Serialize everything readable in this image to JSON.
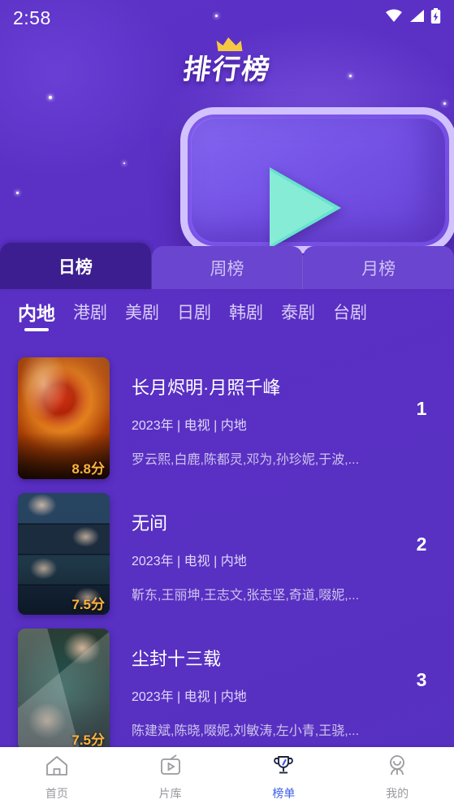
{
  "status_bar": {
    "time": "2:58",
    "icons": [
      "wifi-icon",
      "signal-icon",
      "battery-charging-icon"
    ]
  },
  "banner": {
    "title": "排行榜",
    "crown_color": "#f5c842",
    "play_icon_color": "#67e3cd",
    "background_color": "#5a2fc4"
  },
  "period_tabs": {
    "active_index": 0,
    "items": [
      {
        "label": "日榜"
      },
      {
        "label": "周榜"
      },
      {
        "label": "月榜"
      }
    ]
  },
  "category_tabs": {
    "active_index": 0,
    "items": [
      {
        "label": "内地"
      },
      {
        "label": "港剧"
      },
      {
        "label": "美剧"
      },
      {
        "label": "日剧"
      },
      {
        "label": "韩剧"
      },
      {
        "label": "泰剧"
      },
      {
        "label": "台剧"
      }
    ]
  },
  "ranking_list": [
    {
      "rank": "1",
      "title": "长月烬明·月照千峰",
      "meta": "2023年 | 电视 | 内地",
      "cast": "罗云熙,白鹿,陈都灵,邓为,孙珍妮,于波,...",
      "score": "8.8分"
    },
    {
      "rank": "2",
      "title": "无间",
      "meta": "2023年 | 电视 | 内地",
      "cast": "靳东,王丽坤,王志文,张志坚,奇道,啜妮,...",
      "score": "7.5分"
    },
    {
      "rank": "3",
      "title": "尘封十三载",
      "meta": "2023年 | 电视 | 内地",
      "cast": "陈建斌,陈晓,啜妮,刘敏涛,左小青,王骁,...",
      "score": "7.5分"
    }
  ],
  "bottom_nav": {
    "active_index": 2,
    "active_color": "#3b5ce8",
    "inactive_color": "#9a9a9f",
    "items": [
      {
        "label": "首页",
        "icon": "home-icon"
      },
      {
        "label": "片库",
        "icon": "tv-icon"
      },
      {
        "label": "榜单",
        "icon": "trophy-icon"
      },
      {
        "label": "我的",
        "icon": "profile-icon"
      }
    ]
  }
}
